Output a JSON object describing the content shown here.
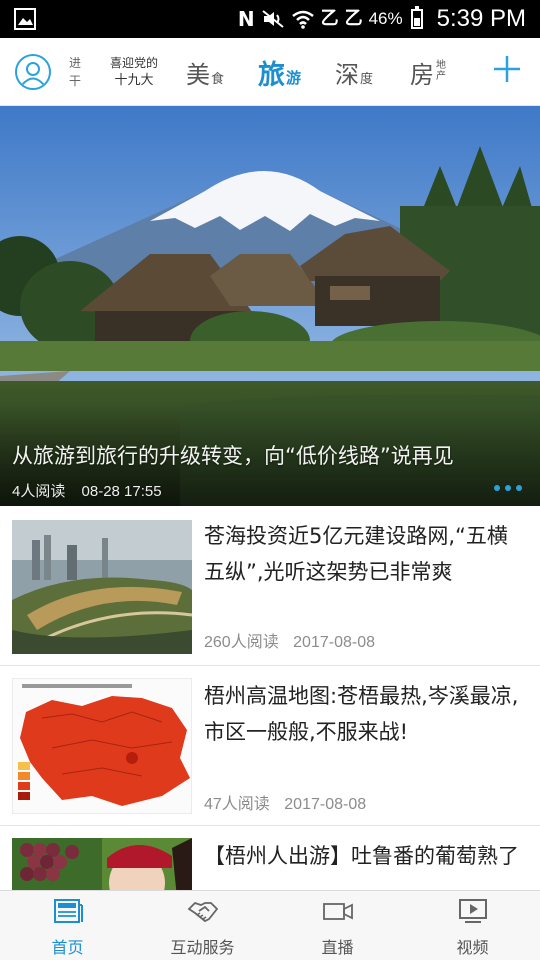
{
  "status_bar": {
    "battery_percent": "46%",
    "time": "5:39 PM",
    "icons": [
      "gallery-icon",
      "n-icon",
      "mute-icon",
      "wifi-icon",
      "signal-icon",
      "signal-icon",
      "battery-icon"
    ],
    "n_glyph": "N",
    "sim1_glyph": "乙",
    "sim2_glyph": "乙"
  },
  "tabs": {
    "partial_tab_top": "进",
    "partial_tab_bottom": "干",
    "special_top": "喜迎党的",
    "special_bottom": "十九大",
    "food_main": "美",
    "food_sub": "食",
    "travel_main": "旅",
    "travel_sub": "游",
    "depth_main": "深",
    "depth_sub": "度",
    "house_main": "房",
    "house_sub_top": "地",
    "house_sub_bottom": "产",
    "active": "travel",
    "accent_color": "#1c8fd0"
  },
  "hero": {
    "title": "从旅游到旅行的升级转变，向“低价线路”说再见",
    "reads": "4人阅读",
    "time": "08-28 17:55",
    "slides": 3
  },
  "news": [
    {
      "title": "苍海投资近5亿元建设路网,“五横五纵”,光听这架势已非常爽",
      "reads": "260人阅读",
      "date": "2017-08-08"
    },
    {
      "title": "梧州高温地图:苍梧最热,岑溪最凉,市区一般般,不服来战!",
      "reads": "47人阅读",
      "date": "2017-08-08"
    },
    {
      "title": "【梧州人出游】吐鲁番的葡萄熟了"
    }
  ],
  "bottom_nav": {
    "home": "首页",
    "service": "互动服务",
    "live": "直播",
    "video": "视频",
    "active": "home"
  }
}
